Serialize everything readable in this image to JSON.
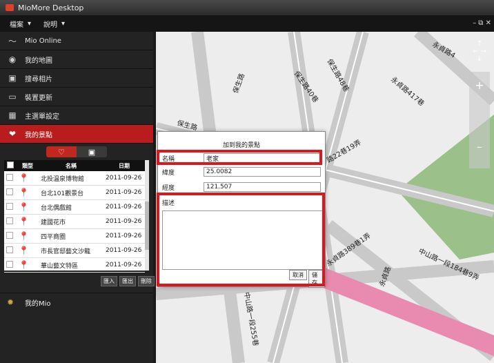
{
  "app": {
    "title": "MioMore Desktop"
  },
  "menu": [
    "檔案",
    "說明"
  ],
  "sidebar": {
    "items": [
      {
        "label": "Mio Online",
        "icon": "wave-icon"
      },
      {
        "label": "我的地圖",
        "icon": "compass-icon"
      },
      {
        "label": "搜尋相片",
        "icon": "camera-icon"
      },
      {
        "label": "裝置更新",
        "icon": "device-icon"
      },
      {
        "label": "主選單設定",
        "icon": "grid-icon"
      },
      {
        "label": "我的景點",
        "icon": "heart-icon",
        "active": true
      }
    ],
    "mymio": "我的Mio"
  },
  "poi_table": {
    "headers": [
      "類型",
      "名稱",
      "日期"
    ],
    "rows": [
      {
        "name": "北投溫泉博物館",
        "date": "2011-09-26"
      },
      {
        "name": "台北101觀景台",
        "date": "2011-09-26"
      },
      {
        "name": "台北偶戲館",
        "date": "2011-09-26"
      },
      {
        "name": "建國花市",
        "date": "2011-09-26"
      },
      {
        "name": "四平商圈",
        "date": "2011-09-26"
      },
      {
        "name": "市長官邸藝文沙龍",
        "date": "2011-09-26"
      },
      {
        "name": "華山藝文特區",
        "date": "2011-09-26"
      }
    ],
    "buttons": [
      "匯入",
      "匯出",
      "刪除"
    ]
  },
  "dialog": {
    "title": "加到我的景點",
    "name_label": "名稱",
    "name_value": "老家",
    "lat_label": "緯度",
    "lat_value": "25.0082",
    "lon_label": "經度",
    "lon_value": "121.507",
    "desc_label": "描述",
    "cancel": "取消",
    "save": "儲存"
  },
  "map": {
    "labels": [
      "保生路48巷",
      "保生路40巷",
      "保生路",
      "永貞路417巷",
      "永貞路4",
      "路22巷19弄",
      "永貞路389巷1弄",
      "中山路一段184巷9弄",
      "永貞路",
      "中山路一段255巷",
      "保生路"
    ]
  }
}
